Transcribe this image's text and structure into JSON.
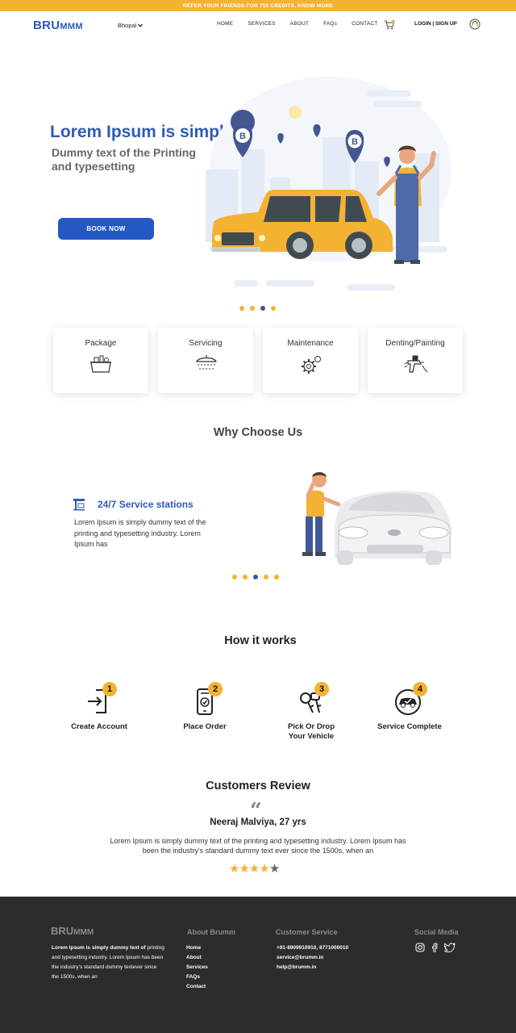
{
  "topbar": {
    "text": "REFER YOUR FRIENDS FOR 750 CREDITS. KNOW MORE"
  },
  "header": {
    "logo_big": "BRU",
    "logo_small": "MMM",
    "city": "Bhopal",
    "menu": [
      "HOME",
      "SERVICES",
      "ABOUT",
      "FAQs",
      "CONTACT"
    ],
    "login": "LOGIN | SIGN UP"
  },
  "hero": {
    "title": "Lorem Ipsum is simply",
    "subtitle": "Dummy text of the Printing and typesetting",
    "cta": "BOOK NOW",
    "pins": [
      "B",
      "B"
    ]
  },
  "services": [
    {
      "label": "Package",
      "icon": "package-basket-icon"
    },
    {
      "label": "Servicing",
      "icon": "car-wash-shower-icon"
    },
    {
      "label": "Maintenance",
      "icon": "gear-maintenance-icon"
    },
    {
      "label": "Denting/Painting",
      "icon": "spray-gun-icon"
    }
  ],
  "why": {
    "title": "Why Choose Us",
    "heading": "24/7 Service stations",
    "text": "Lorem Ipsum is simply dummy text of the printing and typesetting industry. Lorem Ipsum has"
  },
  "how": {
    "title": "How it works",
    "steps": [
      {
        "num": "1",
        "label": "Create Account",
        "icon": "login-arrow-icon"
      },
      {
        "num": "2",
        "label": "Place Order",
        "icon": "phone-order-icon"
      },
      {
        "num": "3",
        "label": "Pick Or Drop Your Vehicle",
        "icon": "car-keys-icon"
      },
      {
        "num": "4",
        "label": "Service Complete",
        "icon": "car-check-icon"
      }
    ]
  },
  "review": {
    "title": "Customers Review",
    "quote": "“",
    "name": "Neeraj Malviya, 27 yrs",
    "text": "Lorem Ipsum is simply dummy text of the printing and typesetting industry. Lorem Ipsum has been the industry's standard dummy text ever since the 1500s, when an",
    "rating": 4,
    "max": 5
  },
  "footer": {
    "logo_big": "BRU",
    "logo_small": "MMM",
    "desc_bold": "Lorem Ipsum is simply dummy text of",
    "desc_rest": "printing and  typesetting industry. Lorem Ipsum has been the industry's standard dummy textever since the 1500s, when an",
    "about_head": "About Brumm",
    "about_links": [
      "Home",
      "About",
      "Services",
      "FAQs",
      "Contact"
    ],
    "cs_head": "Customer Service",
    "cs_lines": [
      "+91-8909910910, 8771000010",
      "service@brumm.in",
      "help@brumm.in"
    ],
    "social_head": "Social Media",
    "social": [
      "instagram-icon",
      "facebook-icon",
      "twitter-icon"
    ]
  },
  "colors": {
    "brand_blue": "#2e5bb8",
    "accent_yellow": "#f4b233",
    "footer_bg": "#2c2c2c"
  }
}
